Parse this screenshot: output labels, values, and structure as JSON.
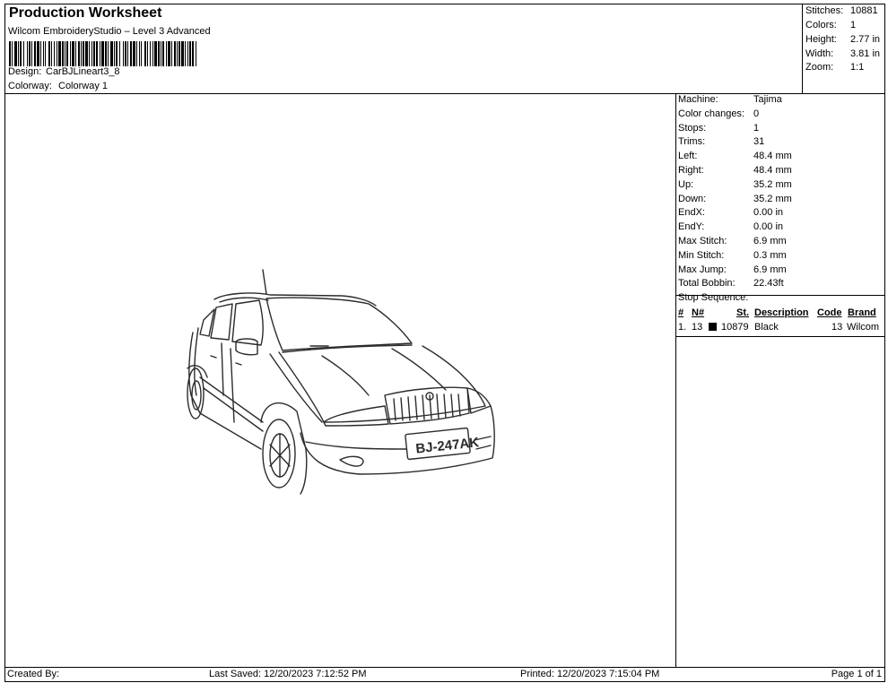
{
  "header": {
    "title": "Production Worksheet",
    "subtitle": "Wilcom EmbroideryStudio – Level 3 Advanced",
    "design_label": "Design:",
    "design_value": "CarBJLineart3_8",
    "colorway_label": "Colorway:",
    "colorway_value": "Colorway 1"
  },
  "stats": [
    {
      "label": "Stitches:",
      "value": "10881"
    },
    {
      "label": "Colors:",
      "value": "1"
    },
    {
      "label": "Height:",
      "value": "2.77 in"
    },
    {
      "label": "Width:",
      "value": "3.81 in"
    },
    {
      "label": "Zoom:",
      "value": "1:1"
    }
  ],
  "properties": [
    {
      "label": "Machine:",
      "value": "Tajima"
    },
    {
      "label": "Color changes:",
      "value": "0"
    },
    {
      "label": "Stops:",
      "value": "1"
    },
    {
      "label": "Trims:",
      "value": "31"
    },
    {
      "label": "Left:",
      "value": "48.4 mm"
    },
    {
      "label": "Right:",
      "value": "48.4 mm"
    },
    {
      "label": "Up:",
      "value": "35.2 mm"
    },
    {
      "label": "Down:",
      "value": "35.2 mm"
    },
    {
      "label": "EndX:",
      "value": "0.00 in"
    },
    {
      "label": "EndY:",
      "value": "0.00 in"
    },
    {
      "label": "Max Stitch:",
      "value": "6.9 mm"
    },
    {
      "label": "Min Stitch:",
      "value": "0.3 mm"
    },
    {
      "label": "Max Jump:",
      "value": "6.9 mm"
    },
    {
      "label": "Total Bobbin:",
      "value": "22.43ft"
    }
  ],
  "stop_sequence": {
    "label": "Stop Sequence:",
    "headers": {
      "num": "#",
      "n": "N#",
      "st": "St.",
      "desc": "Description",
      "code": "Code",
      "brand": "Brand"
    },
    "rows": [
      {
        "num": "1.",
        "n": "13",
        "swatch_color": "#000000",
        "st": "10879",
        "desc": "Black",
        "code": "13",
        "brand": "Wilcom"
      }
    ]
  },
  "design": {
    "plate_text": "BJ-247AK",
    "thread_color": "#2b2b2b"
  },
  "footer": {
    "created_by": "Created By:",
    "last_saved": "Last Saved: 12/20/2023 7:12:52 PM",
    "printed": "Printed: 12/20/2023 7:15:04 PM",
    "page": "Page 1 of 1"
  }
}
